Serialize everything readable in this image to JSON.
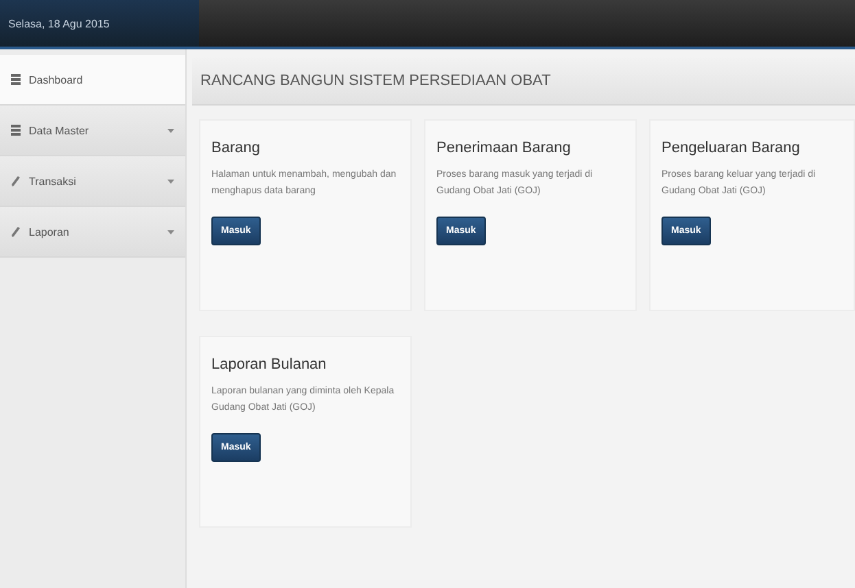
{
  "header": {
    "date": "Selasa, 18 Agu 2015"
  },
  "sidebar": {
    "items": [
      {
        "label": "Dashboard",
        "kind": "list",
        "selected": true,
        "has_submenu": false
      },
      {
        "label": "Data Master",
        "kind": "list",
        "selected": false,
        "has_submenu": true
      },
      {
        "label": "Transaksi",
        "kind": "pencil",
        "selected": false,
        "has_submenu": true
      },
      {
        "label": "Laporan",
        "kind": "pencil",
        "selected": false,
        "has_submenu": true
      }
    ]
  },
  "page_title": "RANCANG BANGUN SISTEM PERSEDIAAN OBAT",
  "cards": [
    {
      "title": "Barang",
      "text": "Halaman untuk menambah, mengubah dan menghapus data barang",
      "button": "Masuk"
    },
    {
      "title": "Penerimaan Barang",
      "text": "Proses barang masuk yang terjadi di Gudang Obat Jati (GOJ)",
      "button": "Masuk"
    },
    {
      "title": "Pengeluaran Barang",
      "text": "Proses barang keluar yang terjadi di Gudang Obat Jati (GOJ)",
      "button": "Masuk"
    },
    {
      "title": "Laporan Bulanan",
      "text": "Laporan bulanan yang diminta oleh Kepala Gudang Obat Jati (GOJ)",
      "button": "Masuk"
    }
  ]
}
